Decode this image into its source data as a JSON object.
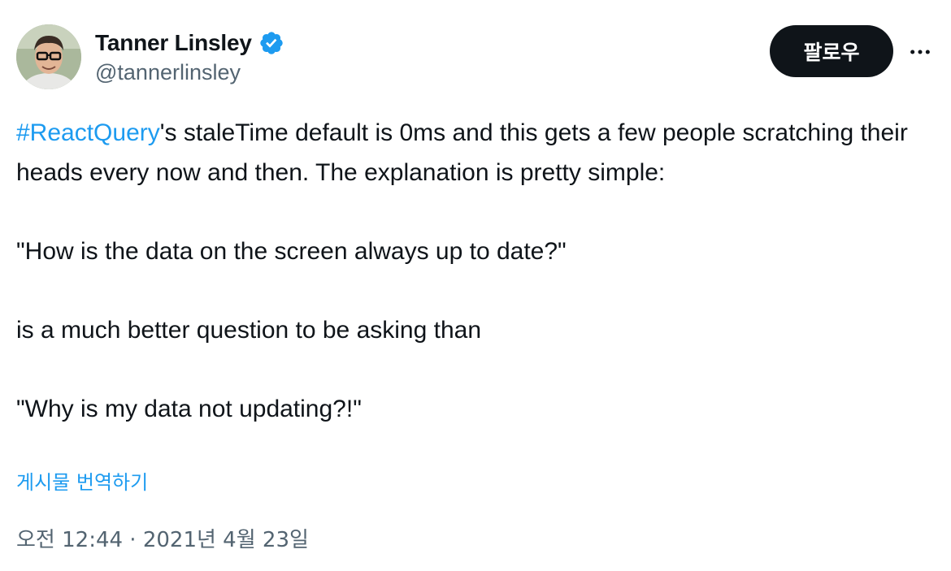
{
  "author": {
    "display_name": "Tanner Linsley",
    "handle": "@tannerlinsley",
    "verified": true,
    "verified_color": "#1d9bf0",
    "avatar_icon": "avatar-photo"
  },
  "actions": {
    "follow_label": "팔로우",
    "more_icon": "more-horizontal-icon"
  },
  "tweet": {
    "hashtag": "#ReactQuery",
    "line1_rest": "'s staleTime default is 0ms and this gets a few people scratching their heads every now and then. The explanation is pretty simple:",
    "para2": "\"How is the data on the screen always up to date?\"",
    "para3": "is a much better question to be asking than",
    "para4": "\"Why is my data not updating?!\""
  },
  "translate_label": "게시물 번역하기",
  "timestamp": "오전 12:44 · 2021년 4월 23일",
  "colors": {
    "text": "#0f1419",
    "secondary": "#536471",
    "accent": "#1d9bf0",
    "button_bg": "#0f1419"
  }
}
